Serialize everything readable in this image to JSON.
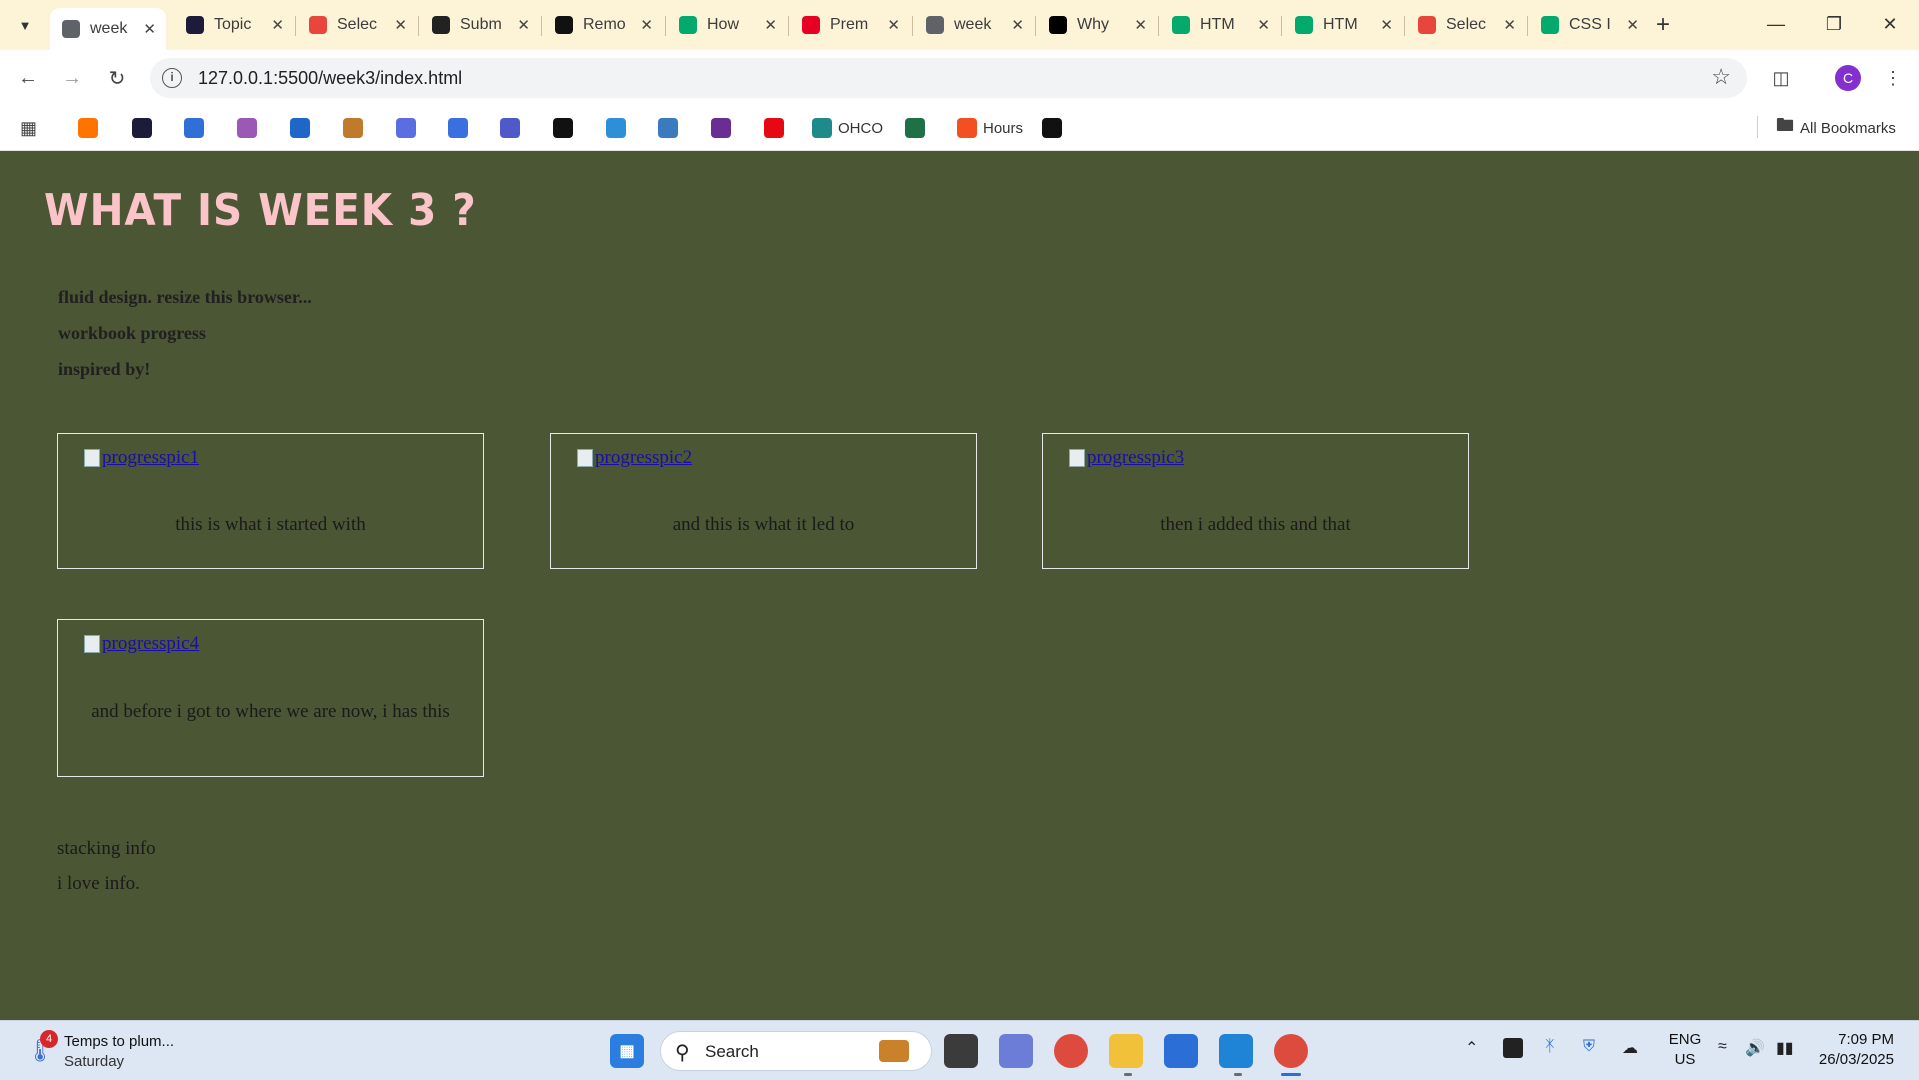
{
  "browser": {
    "tabs": [
      {
        "title": "week",
        "icon": "globe-icon",
        "color": "#5f6368",
        "active": true
      },
      {
        "title": "Topic",
        "icon": "app-icon",
        "color": "#1d1b3a"
      },
      {
        "title": "Selec",
        "icon": "app-icon",
        "color": "#e8453c"
      },
      {
        "title": "Subm",
        "icon": "chatgpt-icon",
        "color": "#222222"
      },
      {
        "title": "Remo",
        "icon": "app-icon",
        "color": "#111111"
      },
      {
        "title": "How",
        "icon": "w3schools-icon",
        "color": "#04aa6d"
      },
      {
        "title": "Prem",
        "icon": "pinterest-icon",
        "color": "#e60023"
      },
      {
        "title": "week",
        "icon": "globe-icon",
        "color": "#5f6368"
      },
      {
        "title": "Why",
        "icon": "medium-icon",
        "color": "#000000"
      },
      {
        "title": "HTM",
        "icon": "w3schools-icon",
        "color": "#04aa6d"
      },
      {
        "title": "HTM",
        "icon": "w3schools-icon",
        "color": "#04aa6d"
      },
      {
        "title": "Selec",
        "icon": "app-icon",
        "color": "#e8453c"
      },
      {
        "title": "CSS I",
        "icon": "w3schools-icon",
        "color": "#04aa6d"
      }
    ],
    "url": "127.0.0.1:5500/week3/index.html",
    "profile_initial": "C",
    "bookmarks": [
      {
        "label": "",
        "color": "#ff7300"
      },
      {
        "label": "",
        "color": "#1d1b3a"
      },
      {
        "label": "",
        "color": "#2f6fd6"
      },
      {
        "label": "",
        "color": "#9b59b6"
      },
      {
        "label": "",
        "color": "#1e66c8"
      },
      {
        "label": "",
        "color": "#c07a2b"
      },
      {
        "label": "",
        "color": "#5b6ee1"
      },
      {
        "label": "",
        "color": "#3a6fe0"
      },
      {
        "label": "",
        "color": "#5059c9"
      },
      {
        "label": "",
        "color": "#111111"
      },
      {
        "label": "",
        "color": "#2d8fd6"
      },
      {
        "label": "",
        "color": "#3a7bbf"
      },
      {
        "label": "",
        "color": "#6a2d91"
      },
      {
        "label": "",
        "color": "#e50914"
      },
      {
        "label": "OHCO",
        "color": "#1f8a8a"
      },
      {
        "label": "",
        "color": "#1e7145"
      },
      {
        "label": "Hours",
        "color": "#f25022"
      },
      {
        "label": "",
        "color": "#111111"
      }
    ],
    "all_bookmarks": "All Bookmarks"
  },
  "page": {
    "heading": "WHAT IS WEEK 3 ?",
    "nav_links": [
      "fluid design. resize this browser...",
      "workbook progress",
      "inspired by!"
    ],
    "cards": [
      {
        "image_alt": "progresspic1",
        "caption": "this is what i started with"
      },
      {
        "image_alt": "progresspic2",
        "caption": "and this is what it led to"
      },
      {
        "image_alt": "progresspic3",
        "caption": "then i added this and that"
      },
      {
        "image_alt": "progresspic4",
        "caption": "and before i got to where we are now, i has this"
      }
    ],
    "stacking": [
      "stacking info",
      "i love info."
    ]
  },
  "taskbar": {
    "weather_badge": "4",
    "weather_title": "Temps to plum...",
    "weather_sub": "Saturday",
    "search_label": "Search",
    "lang_top": "ENG",
    "lang_bottom": "US",
    "time": "7:09 PM",
    "date": "26/03/2025"
  }
}
